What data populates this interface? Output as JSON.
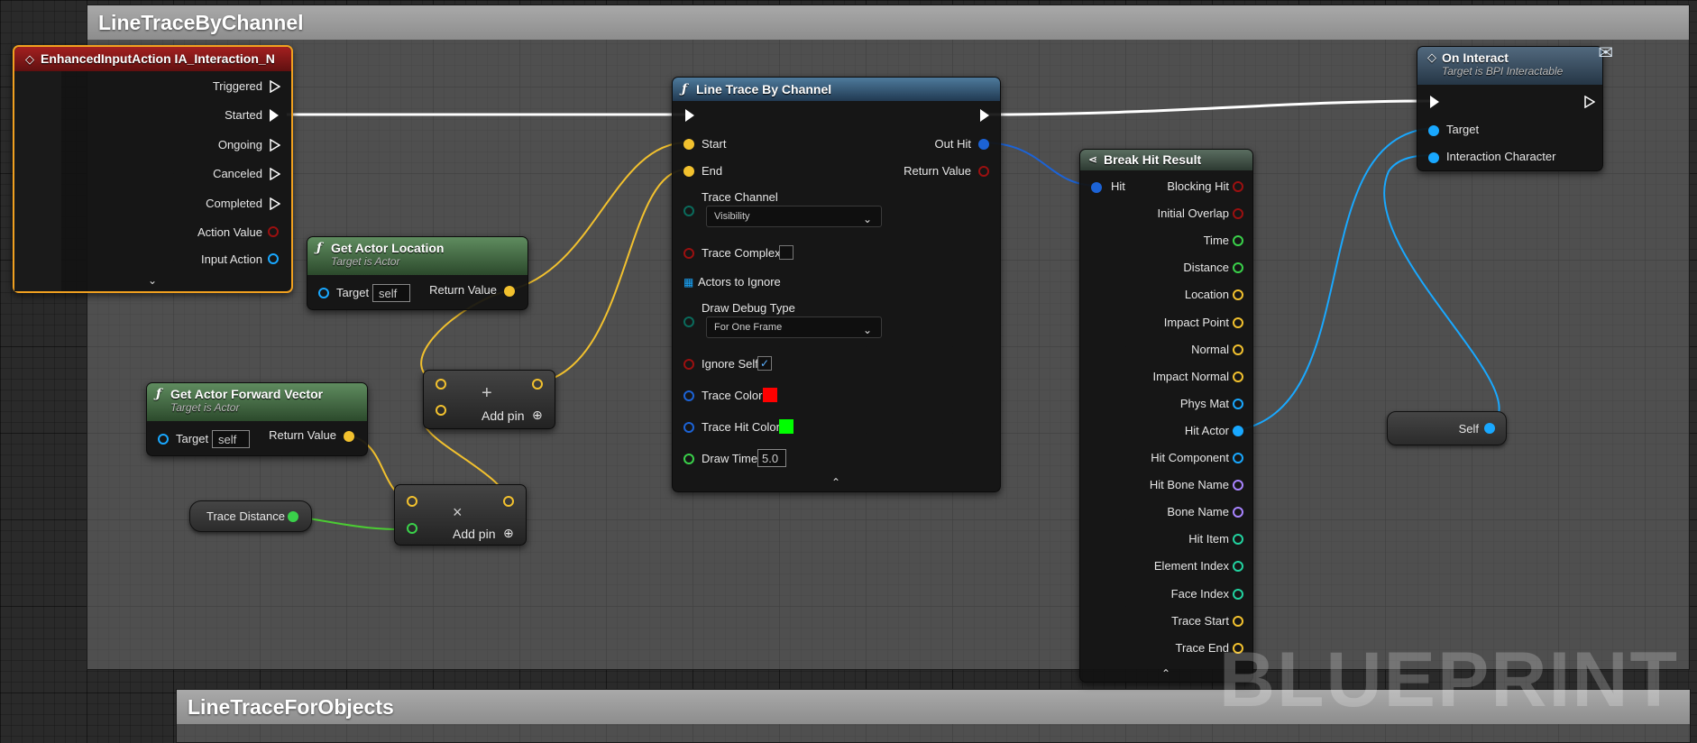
{
  "comments": {
    "top": "LineTraceByChannel",
    "bottom": "LineTraceForObjects"
  },
  "input_event": {
    "title": "EnhancedInputAction IA_Interaction_N",
    "pins": [
      "Triggered",
      "Started",
      "Ongoing",
      "Canceled",
      "Completed",
      "Action Value",
      "Input Action"
    ]
  },
  "get_actor_location": {
    "title": "Get Actor Location",
    "subtitle": "Target is Actor",
    "target_label": "Target",
    "target_value": "self",
    "return_label": "Return Value"
  },
  "get_forward": {
    "title": "Get Actor Forward Vector",
    "subtitle": "Target is Actor",
    "target_label": "Target",
    "target_value": "self",
    "return_label": "Return Value"
  },
  "trace_distance": {
    "label": "Trace Distance"
  },
  "add_node": {
    "label": "Add pin",
    "symbol": "+"
  },
  "mul_node": {
    "label": "Add pin",
    "symbol": "×"
  },
  "line_trace": {
    "title": "Line Trace By Channel",
    "start": "Start",
    "end": "End",
    "out_hit": "Out Hit",
    "return_value": "Return Value",
    "trace_channel": "Trace Channel",
    "trace_channel_value": "Visibility",
    "trace_complex": "Trace Complex",
    "actors_to_ignore": "Actors to Ignore",
    "draw_debug_type": "Draw Debug Type",
    "draw_debug_value": "For One Frame",
    "ignore_self": "Ignore Self",
    "trace_color": "Trace Color",
    "trace_hit_color": "Trace Hit Color",
    "draw_time": "Draw Time",
    "draw_time_value": "5.0",
    "trace_color_hex": "#ff0000",
    "trace_hit_color_hex": "#00ff00"
  },
  "break_hit": {
    "title": "Break Hit Result",
    "input": "Hit",
    "outputs": [
      "Blocking Hit",
      "Initial Overlap",
      "Time",
      "Distance",
      "Location",
      "Impact Point",
      "Normal",
      "Impact Normal",
      "Phys Mat",
      "Hit Actor",
      "Hit Component",
      "Hit Bone Name",
      "Bone Name",
      "Hit Item",
      "Element Index",
      "Face Index",
      "Trace Start",
      "Trace End"
    ]
  },
  "on_interact": {
    "title": "On Interact",
    "subtitle": "Target is BPI Interactable",
    "target": "Target",
    "character": "Interaction Character"
  },
  "self_node": {
    "label": "Self"
  },
  "watermark": "BLUEPRINT",
  "colors": {
    "exec": "#ffffff",
    "vector": "#f2c12e",
    "object": "#19a8ff",
    "bool": "#9b1010",
    "float": "#3ad14a",
    "struct": "#1c63d6",
    "int": "#22d3a0",
    "name": "#a884ff"
  }
}
